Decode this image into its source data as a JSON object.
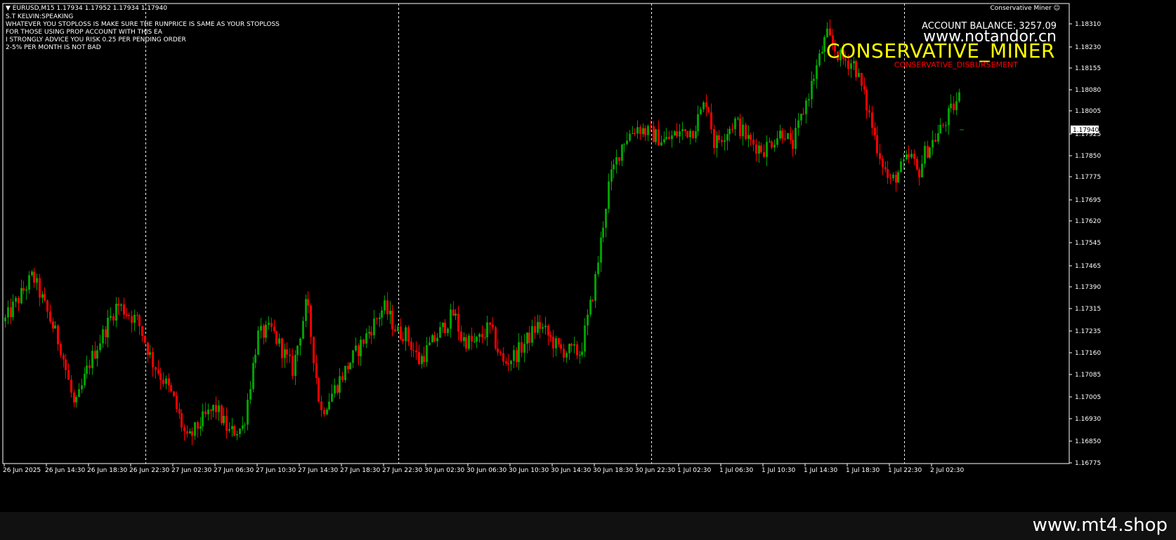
{
  "header": {
    "symbol_line": "EURUSD,M15  1.17934 1.17952 1.17934 1.17940",
    "ea_lines": [
      "S.T KELVIN:SPEAKING",
      "WHATEVER YOU STOPLOSS IS MAKE SURE THE RUNPRICE IS SAME AS YOUR STOPLOSS",
      "FOR THOSE USING PROP ACCOUNT WITH THIS EA",
      "I STRONGLY ADVICE YOU RISK 0.25 PER PENDING ORDER",
      "2-5% PER MONTH IS NOT BAD"
    ]
  },
  "ea": {
    "name": "Conservative Miner",
    "account_balance": "ACCOUNT BALANCE: 3257.09",
    "big_label": "CONSERVATIVE_MINER",
    "sub_label": "CONSERVATIVE_DISBURSEMENT",
    "colors": {
      "big": "#ffff00",
      "sub": "#ff0000"
    }
  },
  "watermark": {
    "url": "www.notandor.cn"
  },
  "footer": {
    "url": "www.mt4.shop"
  },
  "colors": {
    "bull": "#00a000",
    "bear": "#ff0000",
    "grid": "#ffffff",
    "background": "#000000"
  },
  "chart_data": {
    "type": "candlestick",
    "symbol": "EURUSD",
    "timeframe": "M15",
    "current_price": "1.17940",
    "ylim": [
      1.16775,
      1.1831
    ],
    "y_ticks": [
      "1.18310",
      "1.18230",
      "1.18155",
      "1.18080",
      "1.18005",
      "1.17925",
      "1.17850",
      "1.17775",
      "1.17695",
      "1.17620",
      "1.17545",
      "1.17465",
      "1.17390",
      "1.17315",
      "1.17235",
      "1.17160",
      "1.17085",
      "1.17005",
      "1.16930",
      "1.16850",
      "1.16775"
    ],
    "x_ticks": [
      "26 Jun 2025",
      "26 Jun 14:30",
      "26 Jun 18:30",
      "26 Jun 22:30",
      "27 Jun 02:30",
      "27 Jun 06:30",
      "27 Jun 10:30",
      "27 Jun 14:30",
      "27 Jun 18:30",
      "27 Jun 22:30",
      "30 Jun 02:30",
      "30 Jun 06:30",
      "30 Jun 10:30",
      "30 Jun 14:30",
      "30 Jun 18:30",
      "30 Jun 22:30",
      "1 Jul 02:30",
      "1 Jul 06:30",
      "1 Jul 10:30",
      "1 Jul 14:30",
      "1 Jul 18:30",
      "1 Jul 22:30",
      "2 Jul 02:30"
    ],
    "day_separator_ticks": [
      3,
      9,
      15,
      21
    ],
    "price_path": [
      [
        0,
        1.1727
      ],
      [
        2,
        1.1743
      ],
      [
        4,
        1.1718
      ],
      [
        5,
        1.1696
      ],
      [
        6,
        1.1712
      ],
      [
        8,
        1.1733
      ],
      [
        9.5,
        1.1727
      ],
      [
        10.5,
        1.1713
      ],
      [
        11.5,
        1.1705
      ],
      [
        12,
        1.17
      ],
      [
        13,
        1.1685
      ],
      [
        14,
        1.1692
      ],
      [
        15,
        1.1697
      ],
      [
        16,
        1.1688
      ],
      [
        17,
        1.169
      ],
      [
        18,
        1.1722
      ],
      [
        19,
        1.1724
      ],
      [
        20.5,
        1.171
      ],
      [
        21.5,
        1.1734
      ],
      [
        22.5,
        1.1695
      ],
      [
        24.5,
        1.1712
      ],
      [
        25.5,
        1.172
      ],
      [
        27,
        1.1732
      ],
      [
        28,
        1.1723
      ],
      [
        28.5,
        1.1723
      ],
      [
        29.5,
        1.1713
      ],
      [
        30.5,
        1.172
      ],
      [
        32,
        1.173
      ],
      [
        32.5,
        1.1721
      ],
      [
        33.5,
        1.1719
      ],
      [
        34.5,
        1.1725
      ],
      [
        35.5,
        1.1712
      ],
      [
        36.5,
        1.1716
      ],
      [
        38,
        1.1726
      ],
      [
        39.5,
        1.1717
      ],
      [
        41,
        1.1716
      ],
      [
        42,
        1.174
      ],
      [
        43,
        1.1775
      ],
      [
        44,
        1.179
      ],
      [
        45,
        1.1795
      ],
      [
        47,
        1.179
      ],
      [
        48,
        1.1793
      ],
      [
        49,
        1.1794
      ],
      [
        50,
        1.1805
      ],
      [
        50.5,
        1.1789
      ],
      [
        52,
        1.1797
      ],
      [
        53,
        1.179
      ],
      [
        54,
        1.1787
      ],
      [
        55,
        1.1792
      ],
      [
        55.5,
        1.1794
      ],
      [
        56,
        1.1787
      ],
      [
        58.5,
        1.1827
      ],
      [
        59.5,
        1.1819
      ],
      [
        60.5,
        1.1817
      ],
      [
        61.5,
        1.18
      ],
      [
        62,
        1.179
      ],
      [
        63,
        1.1775
      ],
      [
        64.5,
        1.1785
      ],
      [
        65,
        1.1778
      ],
      [
        65.5,
        1.1786
      ],
      [
        66.5,
        1.1793
      ],
      [
        68,
        1.1806
      ],
      [
        69.5,
        1.1804
      ],
      [
        71.5,
        1.1804
      ],
      [
        72,
        1.1794
      ]
    ]
  }
}
